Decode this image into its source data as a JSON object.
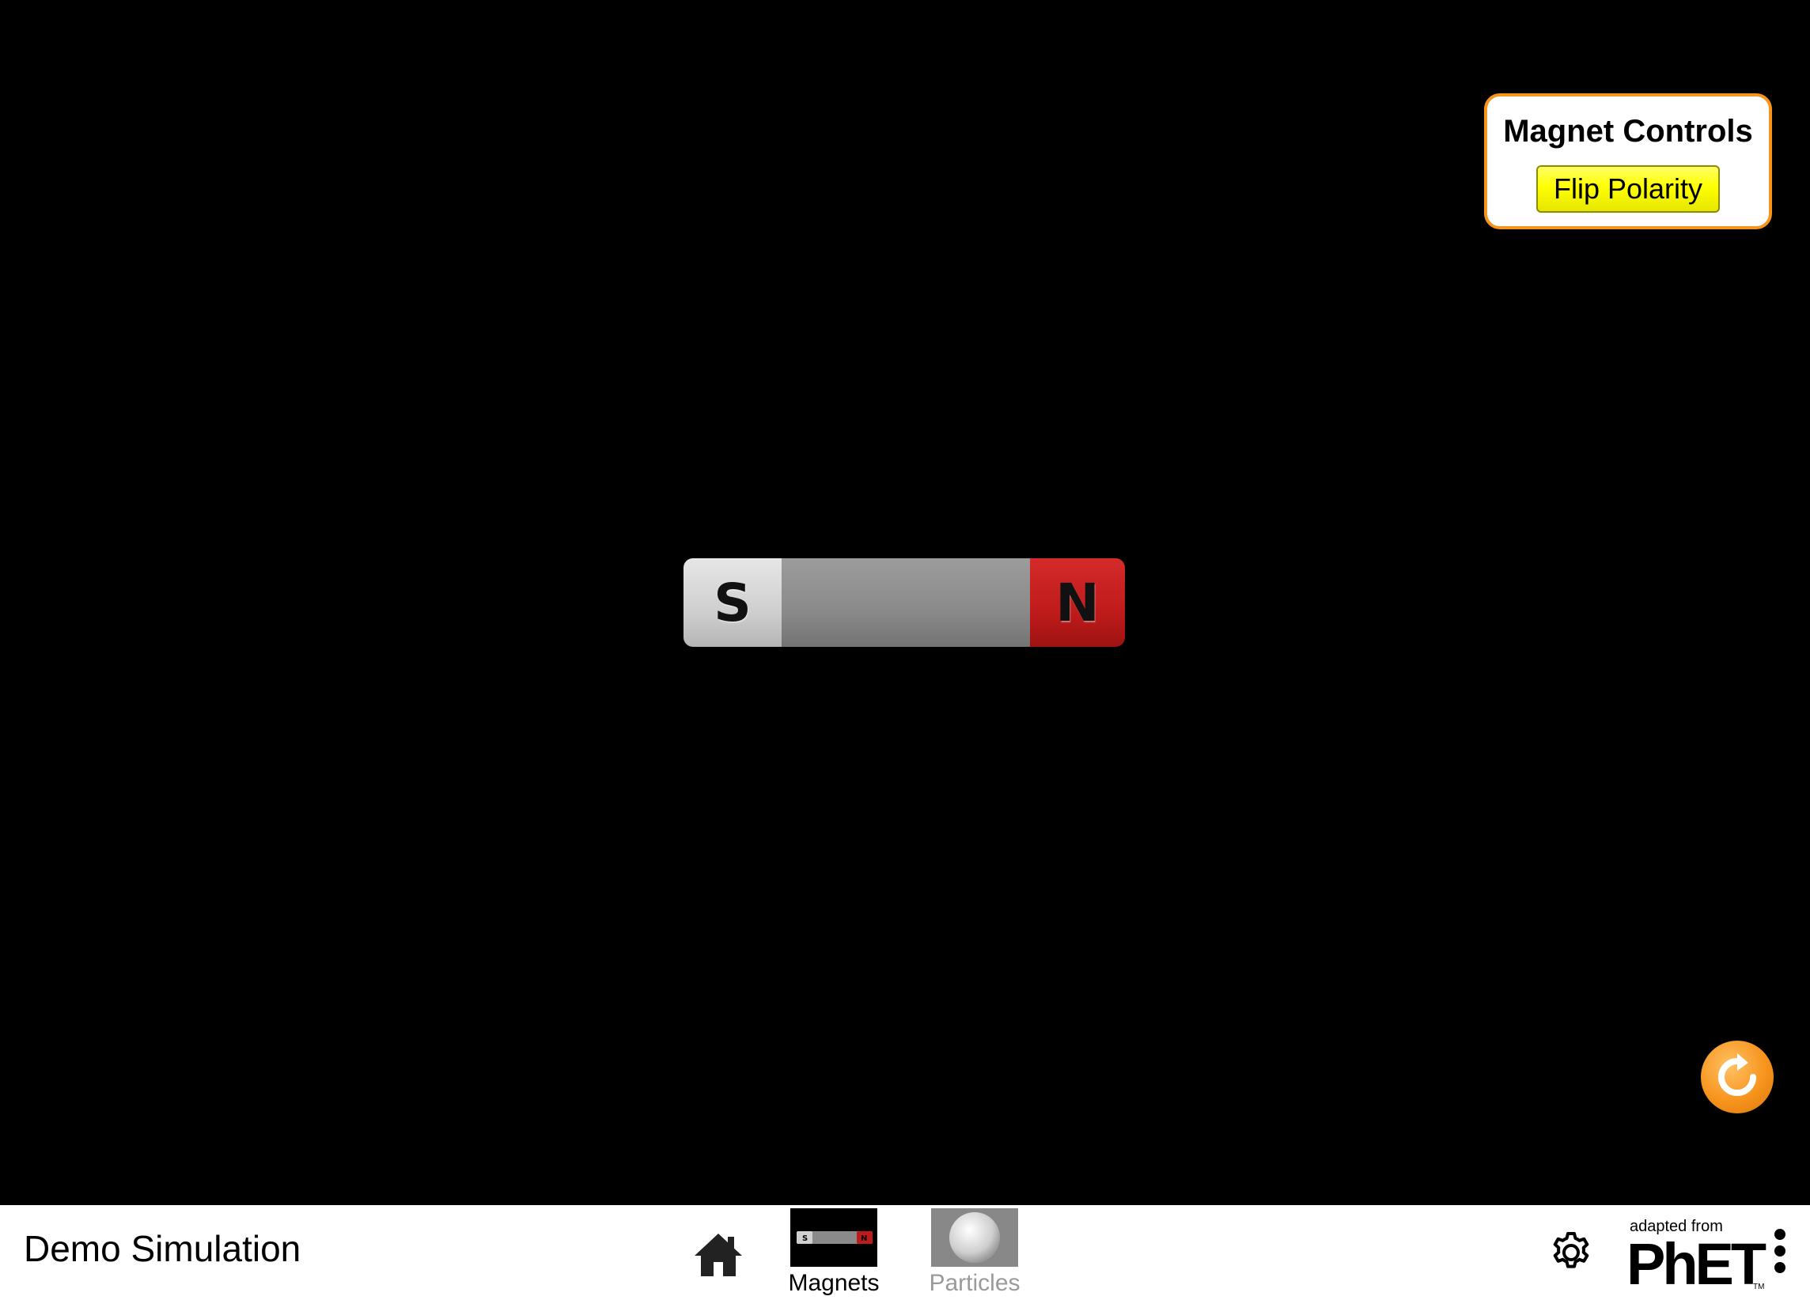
{
  "panel": {
    "title": "Magnet Controls",
    "flip_label": "Flip Polarity",
    "border_color": "#f7941d",
    "button_color": "#ffff00"
  },
  "magnet": {
    "south_label": "S",
    "north_label": "N",
    "south_color": "#d0d0d0",
    "body_color": "#8a8a8a",
    "north_color": "#c01b1b"
  },
  "reset": {
    "icon": "reset-all-icon",
    "color": "#f7941d"
  },
  "navbar": {
    "title": "Demo Simulation",
    "home_icon": "home-icon",
    "tabs": [
      {
        "label": "Magnets",
        "icon": "bar-magnet-icon",
        "selected": true
      },
      {
        "label": "Particles",
        "icon": "sphere-icon",
        "selected": false
      }
    ],
    "settings_icon": "gear-icon",
    "logo": {
      "prefix": "adapted from",
      "name": "PhET",
      "tm": "TM"
    },
    "menu_icon": "vertical-dots-icon"
  }
}
